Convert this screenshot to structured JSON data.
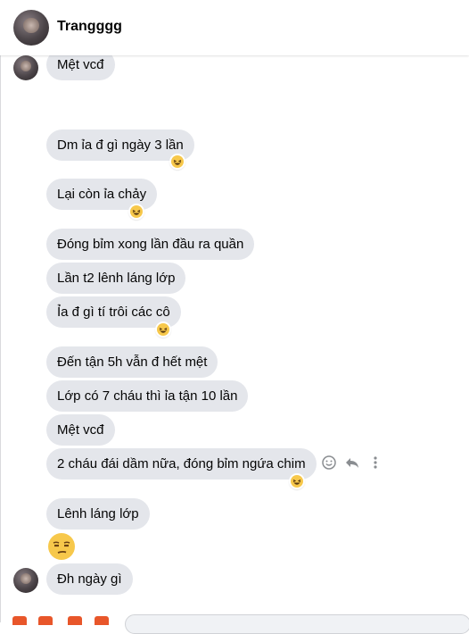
{
  "header": {
    "contact_name": "Trangggg"
  },
  "messages": [
    {
      "text": "Mệt vcđ"
    },
    {
      "text": "Dm ỉa đ gì ngày 3 lần",
      "reaction": "😆"
    },
    {
      "text": "Lại còn ỉa chảy",
      "reaction": "😆"
    },
    {
      "text": "Đóng bỉm xong lần đầu ra quần"
    },
    {
      "text": "Lần t2 lênh láng lớp"
    },
    {
      "text": "Ỉa đ gì tí trôi các cô",
      "reaction": "😆"
    },
    {
      "text": "Đến tận 5h vẫn đ hết mệt"
    },
    {
      "text": "Lớp có 7 cháu thì ỉa tận 10 lần"
    },
    {
      "text": "Mệt vcđ"
    },
    {
      "text": "2 cháu đái dầm nữa, đóng bỉm ngứa chim",
      "reaction": "😆"
    },
    {
      "text": "Lênh láng lớp"
    },
    {
      "emoji": "😒"
    },
    {
      "text": "Đh ngày gì"
    }
  ],
  "icons": {
    "reaction_laugh": "laughing-emoji-icon",
    "react_tool": "smiley-icon",
    "reply_tool": "reply-icon",
    "more_tool": "more-vertical-icon",
    "big_emoji": "unamused-emoji-icon"
  },
  "colors": {
    "bubble": "#e4e6eb",
    "accent": "#e8562a",
    "icon_gray": "#8a8d91"
  }
}
